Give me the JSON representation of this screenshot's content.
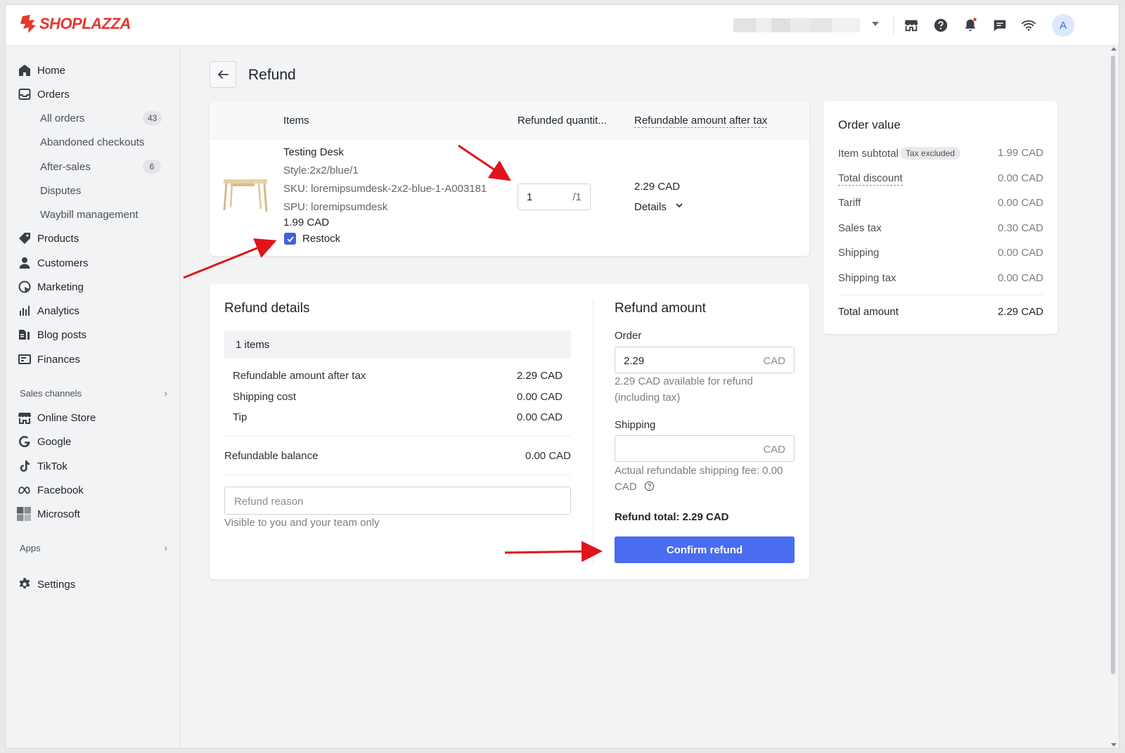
{
  "app": {
    "logo": "SHOPLAZZA"
  },
  "topbar": {
    "avatar_letter": "A"
  },
  "sidebar": {
    "main": [
      {
        "label": "Home",
        "icon": "home-icon"
      },
      {
        "label": "Orders",
        "icon": "orders-icon"
      }
    ],
    "orders_sub": [
      {
        "label": "All orders",
        "badge": "43"
      },
      {
        "label": "Abandoned checkouts",
        "badge": ""
      },
      {
        "label": "After-sales",
        "badge": "6"
      },
      {
        "label": "Disputes",
        "badge": ""
      },
      {
        "label": "Waybill management",
        "badge": ""
      }
    ],
    "more": [
      {
        "label": "Products",
        "icon": "tag-icon"
      },
      {
        "label": "Customers",
        "icon": "user-icon"
      },
      {
        "label": "Marketing",
        "icon": "marketing-icon"
      },
      {
        "label": "Analytics",
        "icon": "bar-chart-icon"
      },
      {
        "label": "Blog posts",
        "icon": "blog-icon"
      },
      {
        "label": "Finances",
        "icon": "finance-icon"
      }
    ],
    "sales_channels_title": "Sales channels",
    "channels": [
      {
        "label": "Online Store",
        "icon": "store-icon"
      },
      {
        "label": "Google",
        "icon": "google-icon"
      },
      {
        "label": "TikTok",
        "icon": "tiktok-icon"
      },
      {
        "label": "Facebook",
        "icon": "meta-icon"
      },
      {
        "label": "Microsoft",
        "icon": "microsoft-icon"
      }
    ],
    "apps_title": "Apps",
    "settings": "Settings"
  },
  "page": {
    "title": "Refund"
  },
  "items_table": {
    "col_items": "Items",
    "col_qty": "Refunded quantit...",
    "col_amount": "Refundable amount after tax",
    "product": {
      "name": "Testing Desk",
      "style": "Style:2x2/blue/1",
      "sku": "SKU: loremipsumdesk-2x2-blue-1-A003181",
      "spu": "SPU: loremipsumdesk",
      "price": "1.99 CAD",
      "restock_label": "Restock",
      "qty_value": "1",
      "qty_max": "/1",
      "refundable": "2.29 CAD",
      "details_label": "Details"
    }
  },
  "refund_details": {
    "title": "Refund details",
    "items_count": "1 items",
    "rows": [
      {
        "label": "Refundable amount after tax",
        "value": "2.29 CAD"
      },
      {
        "label": "Shipping cost",
        "value": "0.00 CAD"
      },
      {
        "label": "Tip",
        "value": "0.00 CAD"
      }
    ],
    "balance_label": "Refundable balance",
    "balance_value": "0.00 CAD",
    "reason_placeholder": "Refund reason",
    "reason_help": "Visible to you and your team only"
  },
  "refund_amount": {
    "title": "Refund amount",
    "order_label": "Order",
    "order_value": "2.29",
    "currency": "CAD",
    "order_help_1": "2.29 CAD available for refund",
    "order_help_2": "(including tax)",
    "shipping_label": "Shipping",
    "shipping_help_1": "Actual refundable shipping fee: 0.00",
    "shipping_help_2": "CAD",
    "total": "Refund total: 2.29 CAD",
    "confirm": "Confirm refund"
  },
  "order_value": {
    "title": "Order value",
    "tax_tag": "Tax excluded",
    "rows": [
      {
        "label": "Item subtotal",
        "value": "1.99 CAD"
      },
      {
        "label": "Total discount",
        "value": "0.00 CAD"
      },
      {
        "label": "Tariff",
        "value": "0.00 CAD"
      },
      {
        "label": "Sales tax",
        "value": "0.30 CAD"
      },
      {
        "label": "Shipping",
        "value": "0.00 CAD"
      },
      {
        "label": "Shipping tax",
        "value": "0.00 CAD"
      }
    ],
    "total_label": "Total amount",
    "total_value": "2.29 CAD"
  },
  "colors": {
    "brand": "#e8372c",
    "primary": "#4a6cf0",
    "annotation": "#e0141b"
  }
}
